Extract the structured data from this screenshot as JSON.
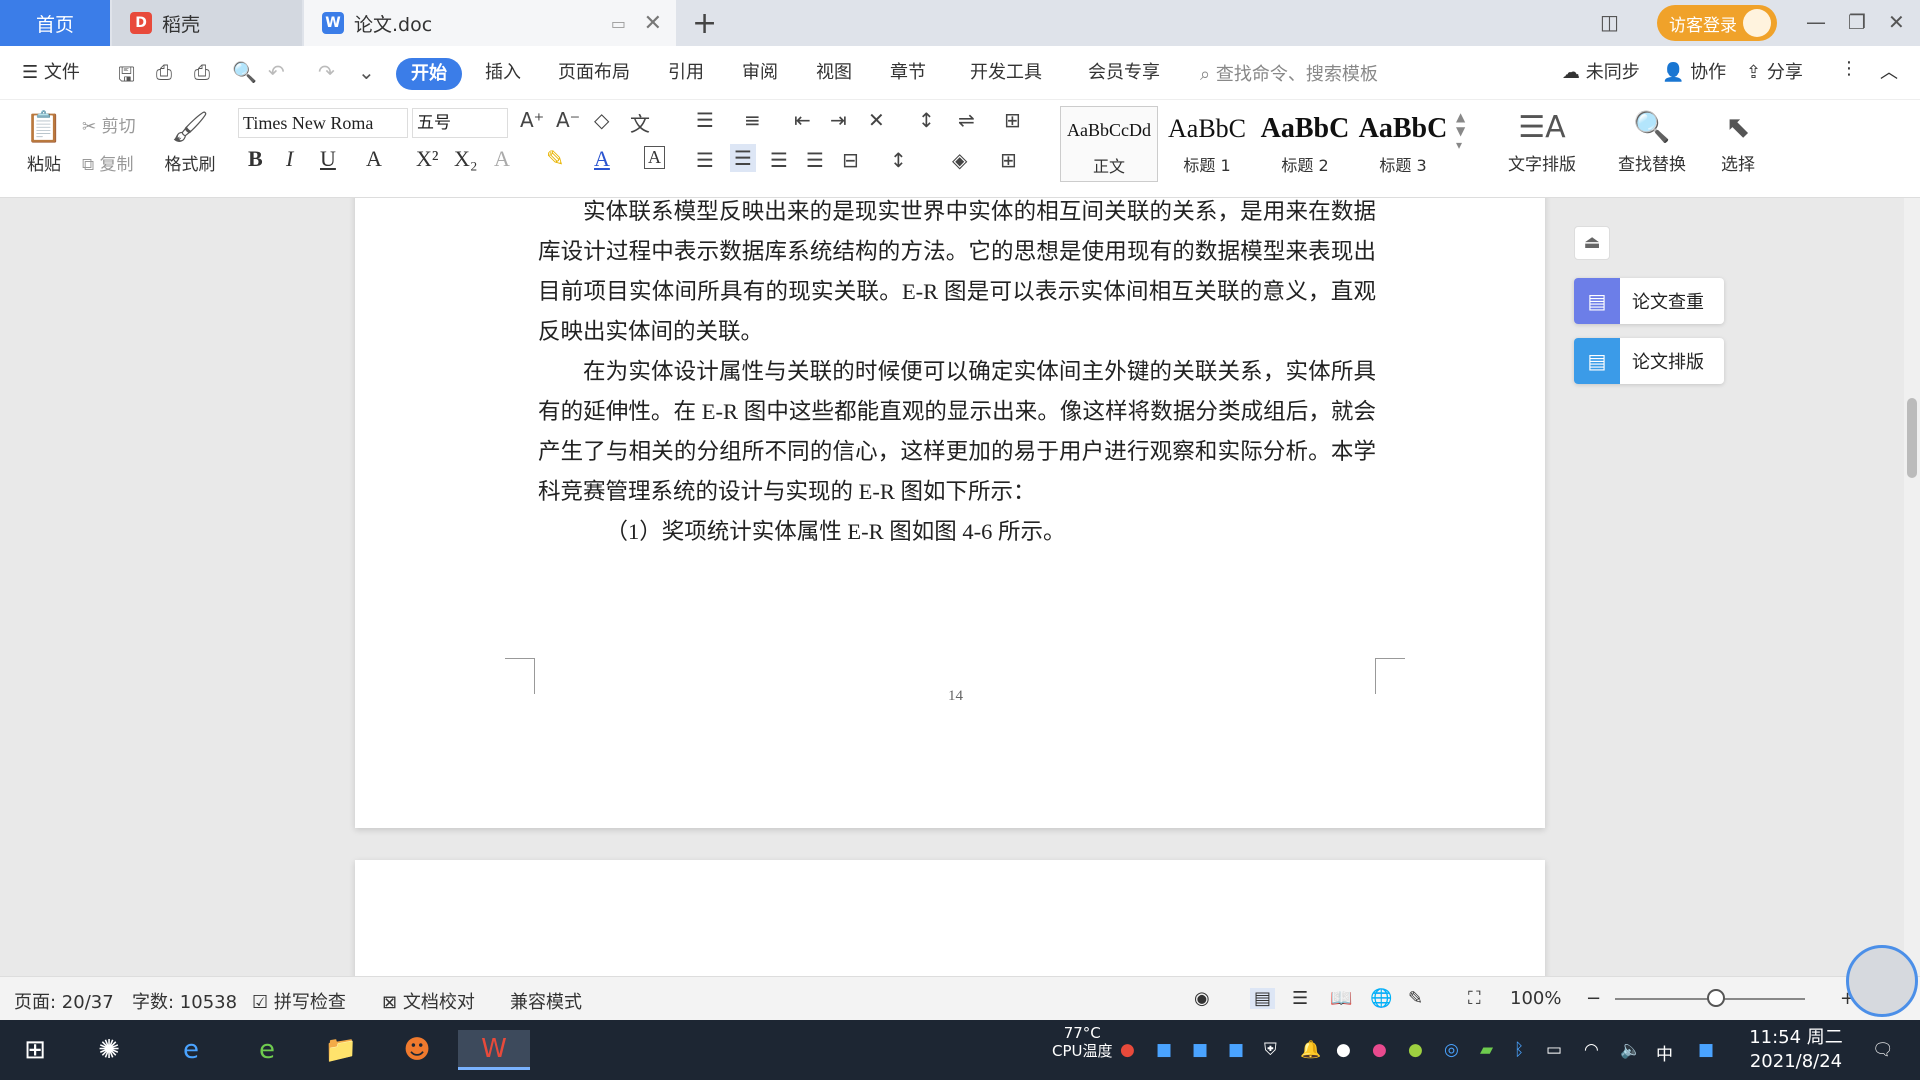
{
  "tabs": {
    "home": "首页",
    "daoke": "稻壳",
    "doc": "论文.doc"
  },
  "titlebar": {
    "visitor_login": "访客登录"
  },
  "menu": {
    "file": "文件",
    "items": [
      "开始",
      "插入",
      "页面布局",
      "引用",
      "审阅",
      "视图",
      "章节",
      "开发工具",
      "会员专享"
    ],
    "search_placeholder": "查找命令、搜索模板",
    "sync": "未同步",
    "collab": "协作",
    "share": "分享"
  },
  "ribbon": {
    "paste": "粘贴",
    "cut": "剪切",
    "copy": "复制",
    "format_painter": "格式刷",
    "font_name": "Times New Roma",
    "font_size": "五号",
    "styles": [
      {
        "preview": "AaBbCcDd",
        "label": "正文"
      },
      {
        "preview": "AaBbC",
        "label": "标题 1"
      },
      {
        "preview": "AaBbC",
        "label": "标题 2"
      },
      {
        "preview": "AaBbC",
        "label": "标题 3"
      }
    ],
    "text_layout": "文字排版",
    "find_replace": "查找替换",
    "select": "选择"
  },
  "document": {
    "paragraphs": [
      "实体联系模型反映出来的是现实世界中实体的相互间关联的关系，是用来在数据库设计过程中表示数据库系统结构的方法。它的思想是使用现有的数据模型来表现出目前项目实体间所具有的现实关联。E-R 图是可以表示实体间相互关联的意义，直观反映出实体间的关联。",
      "在为实体设计属性与关联的时候便可以确定实体间主外键的关联关系，实体所具有的延伸性。在 E-R 图中这些都能直观的显示出来。像这样将数据分类成组后，就会产生了与相关的分组所不同的信心，这样更加的易于用户进行观察和实际分析。本学科竞赛管理系统的设计与实现的 E-R 图如下所示：",
      "（1）奖项统计实体属性 E-R 图如图 4-6 所示。"
    ],
    "page_number": "14"
  },
  "side_panel": {
    "check": "论文查重",
    "layout": "论文排版"
  },
  "statusbar": {
    "page": "页面: 20/37",
    "words": "字数: 10538",
    "spell_check": "拼写检查",
    "doc_proof": "文档校对",
    "compat": "兼容模式",
    "zoom": "100%",
    "zoom_level_fraction": 0.5
  },
  "taskbar": {
    "temp": "77°C",
    "cpu": "CPU温度",
    "ime": "中",
    "time": "11:54 周二",
    "date": "2021/8/24"
  },
  "colors": {
    "accent": "#3b7de8",
    "visitor": "#f0a22a",
    "taskbar": "#1d2633"
  }
}
